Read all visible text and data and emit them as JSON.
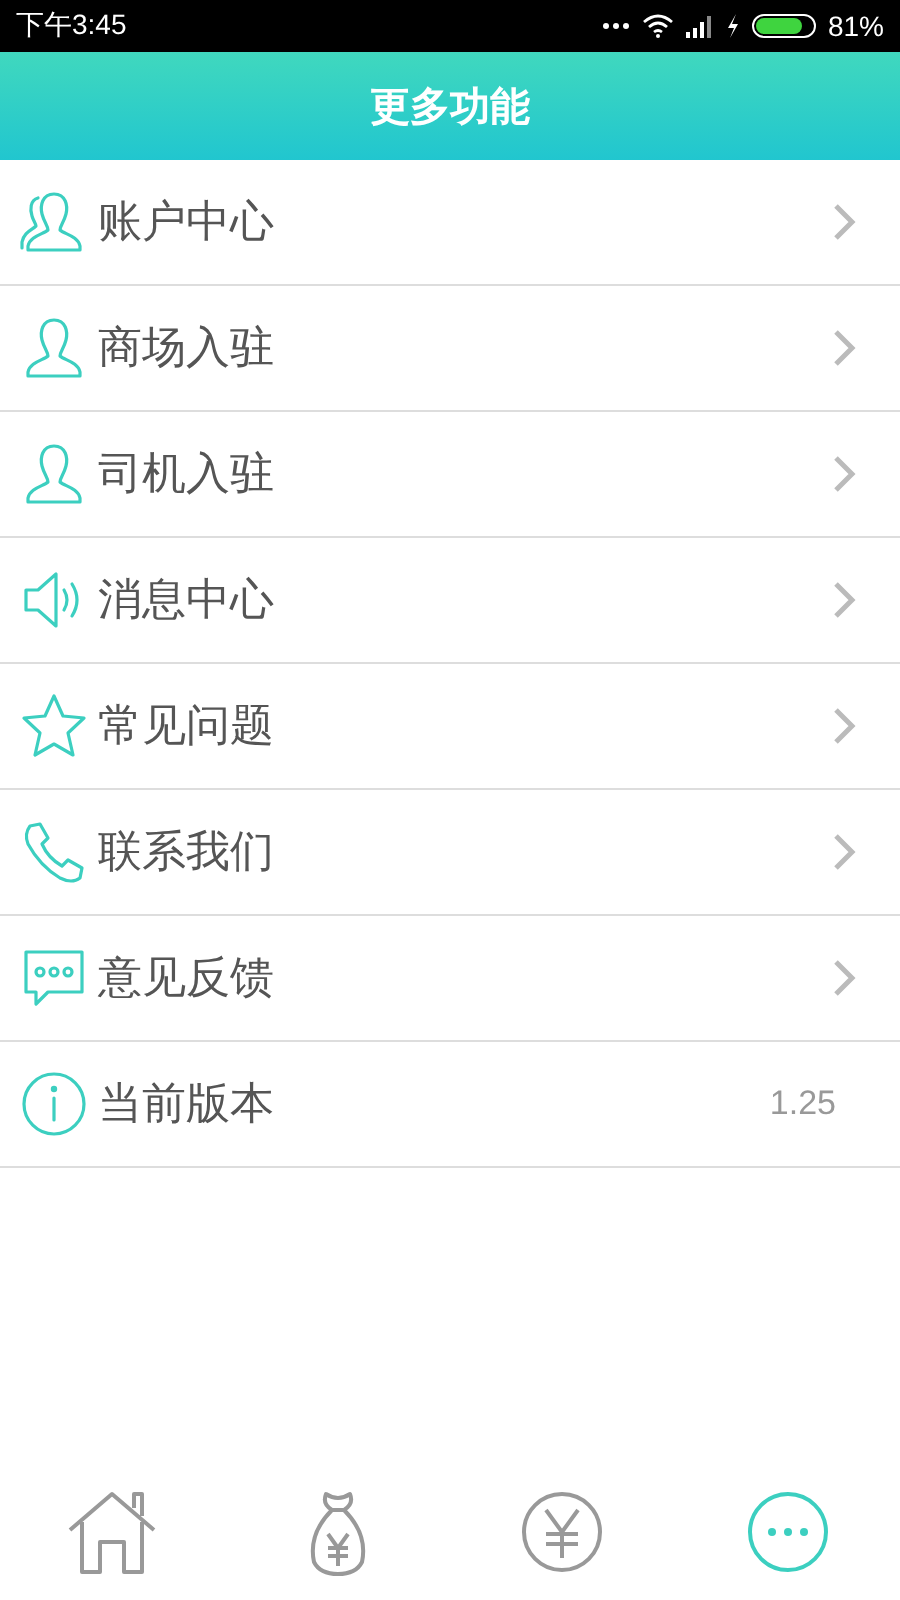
{
  "status_bar": {
    "time": "下午3:45",
    "battery": "81%"
  },
  "header": {
    "title": "更多功能"
  },
  "menu": [
    {
      "label": "账户中心",
      "kind": "link"
    },
    {
      "label": "商场入驻",
      "kind": "link"
    },
    {
      "label": "司机入驻",
      "kind": "link"
    },
    {
      "label": "消息中心",
      "kind": "link"
    },
    {
      "label": "常见问题",
      "kind": "link"
    },
    {
      "label": "联系我们",
      "kind": "link"
    },
    {
      "label": "意见反馈",
      "kind": "link"
    },
    {
      "label": "当前版本",
      "kind": "value",
      "value": "1.25"
    }
  ],
  "bottom_nav": [
    {
      "selected": false
    },
    {
      "selected": false
    },
    {
      "selected": false
    },
    {
      "selected": true
    }
  ]
}
